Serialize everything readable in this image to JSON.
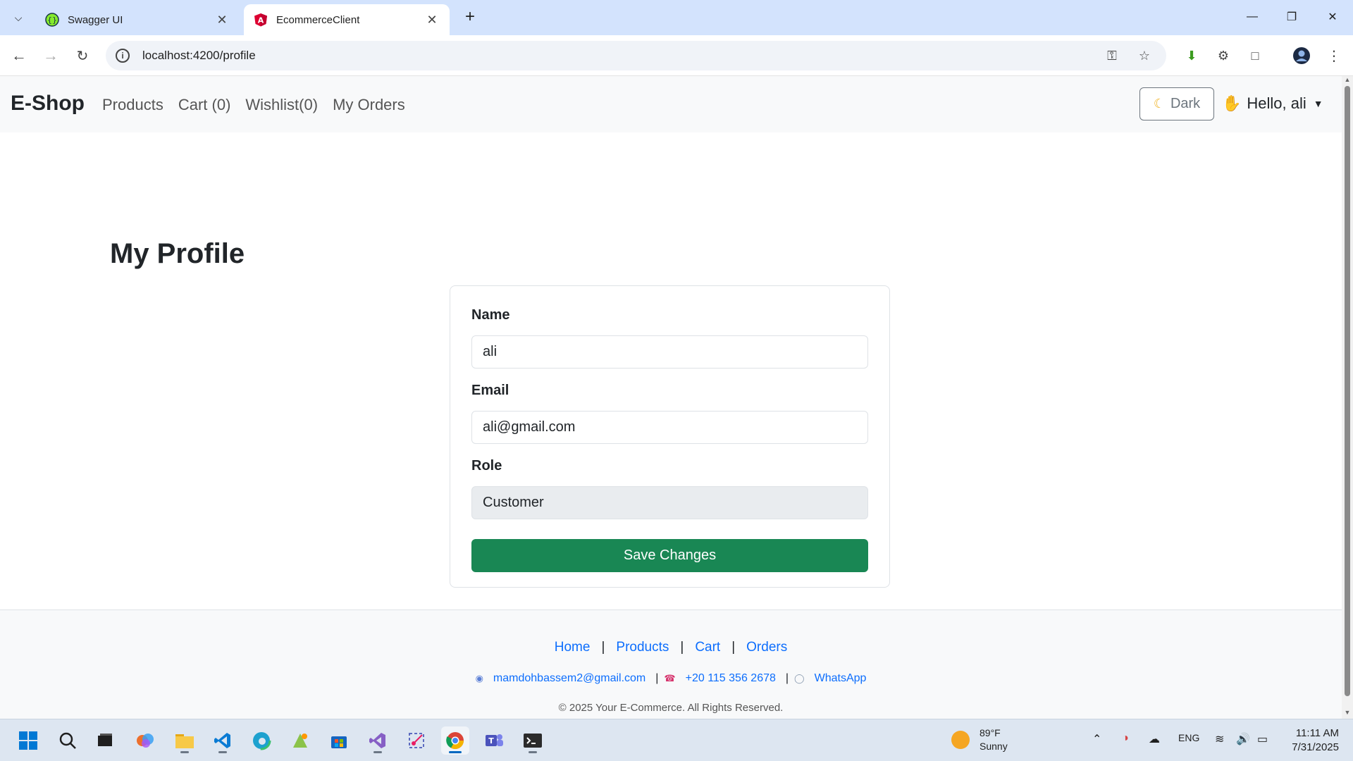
{
  "browser": {
    "tabs": [
      {
        "title": "Swagger UI",
        "active": false
      },
      {
        "title": "EcommerceClient",
        "active": true
      }
    ],
    "url": "localhost:4200/profile"
  },
  "navbar": {
    "brand": "E-Shop",
    "links": [
      "Products",
      "Cart (0)",
      "Wishlist(0)",
      "My Orders"
    ],
    "theme_toggle": "Dark",
    "greeting": "Hello, ali"
  },
  "profile": {
    "title": "My Profile",
    "name_label": "Name",
    "name_value": "ali",
    "email_label": "Email",
    "email_value": "ali@gmail.com",
    "role_label": "Role",
    "role_value": "Customer",
    "save_label": "Save Changes"
  },
  "footer": {
    "links": [
      "Home",
      "Products",
      "Cart",
      "Orders"
    ],
    "email": "mamdohbassem2@gmail.com",
    "phone": "+20 115 356 2678",
    "whatsapp": "WhatsApp",
    "copyright": "© 2025 Your E-Commerce. All Rights Reserved."
  },
  "taskbar": {
    "weather_temp": "89°F",
    "weather_desc": "Sunny",
    "language": "ENG",
    "time": "11:11 AM",
    "date": "7/31/2025"
  },
  "colors": {
    "primary_link": "#0d6efd",
    "success": "#198754",
    "navbar_bg": "#f8f9fa",
    "tabbar_bg": "#d3e3fd"
  }
}
